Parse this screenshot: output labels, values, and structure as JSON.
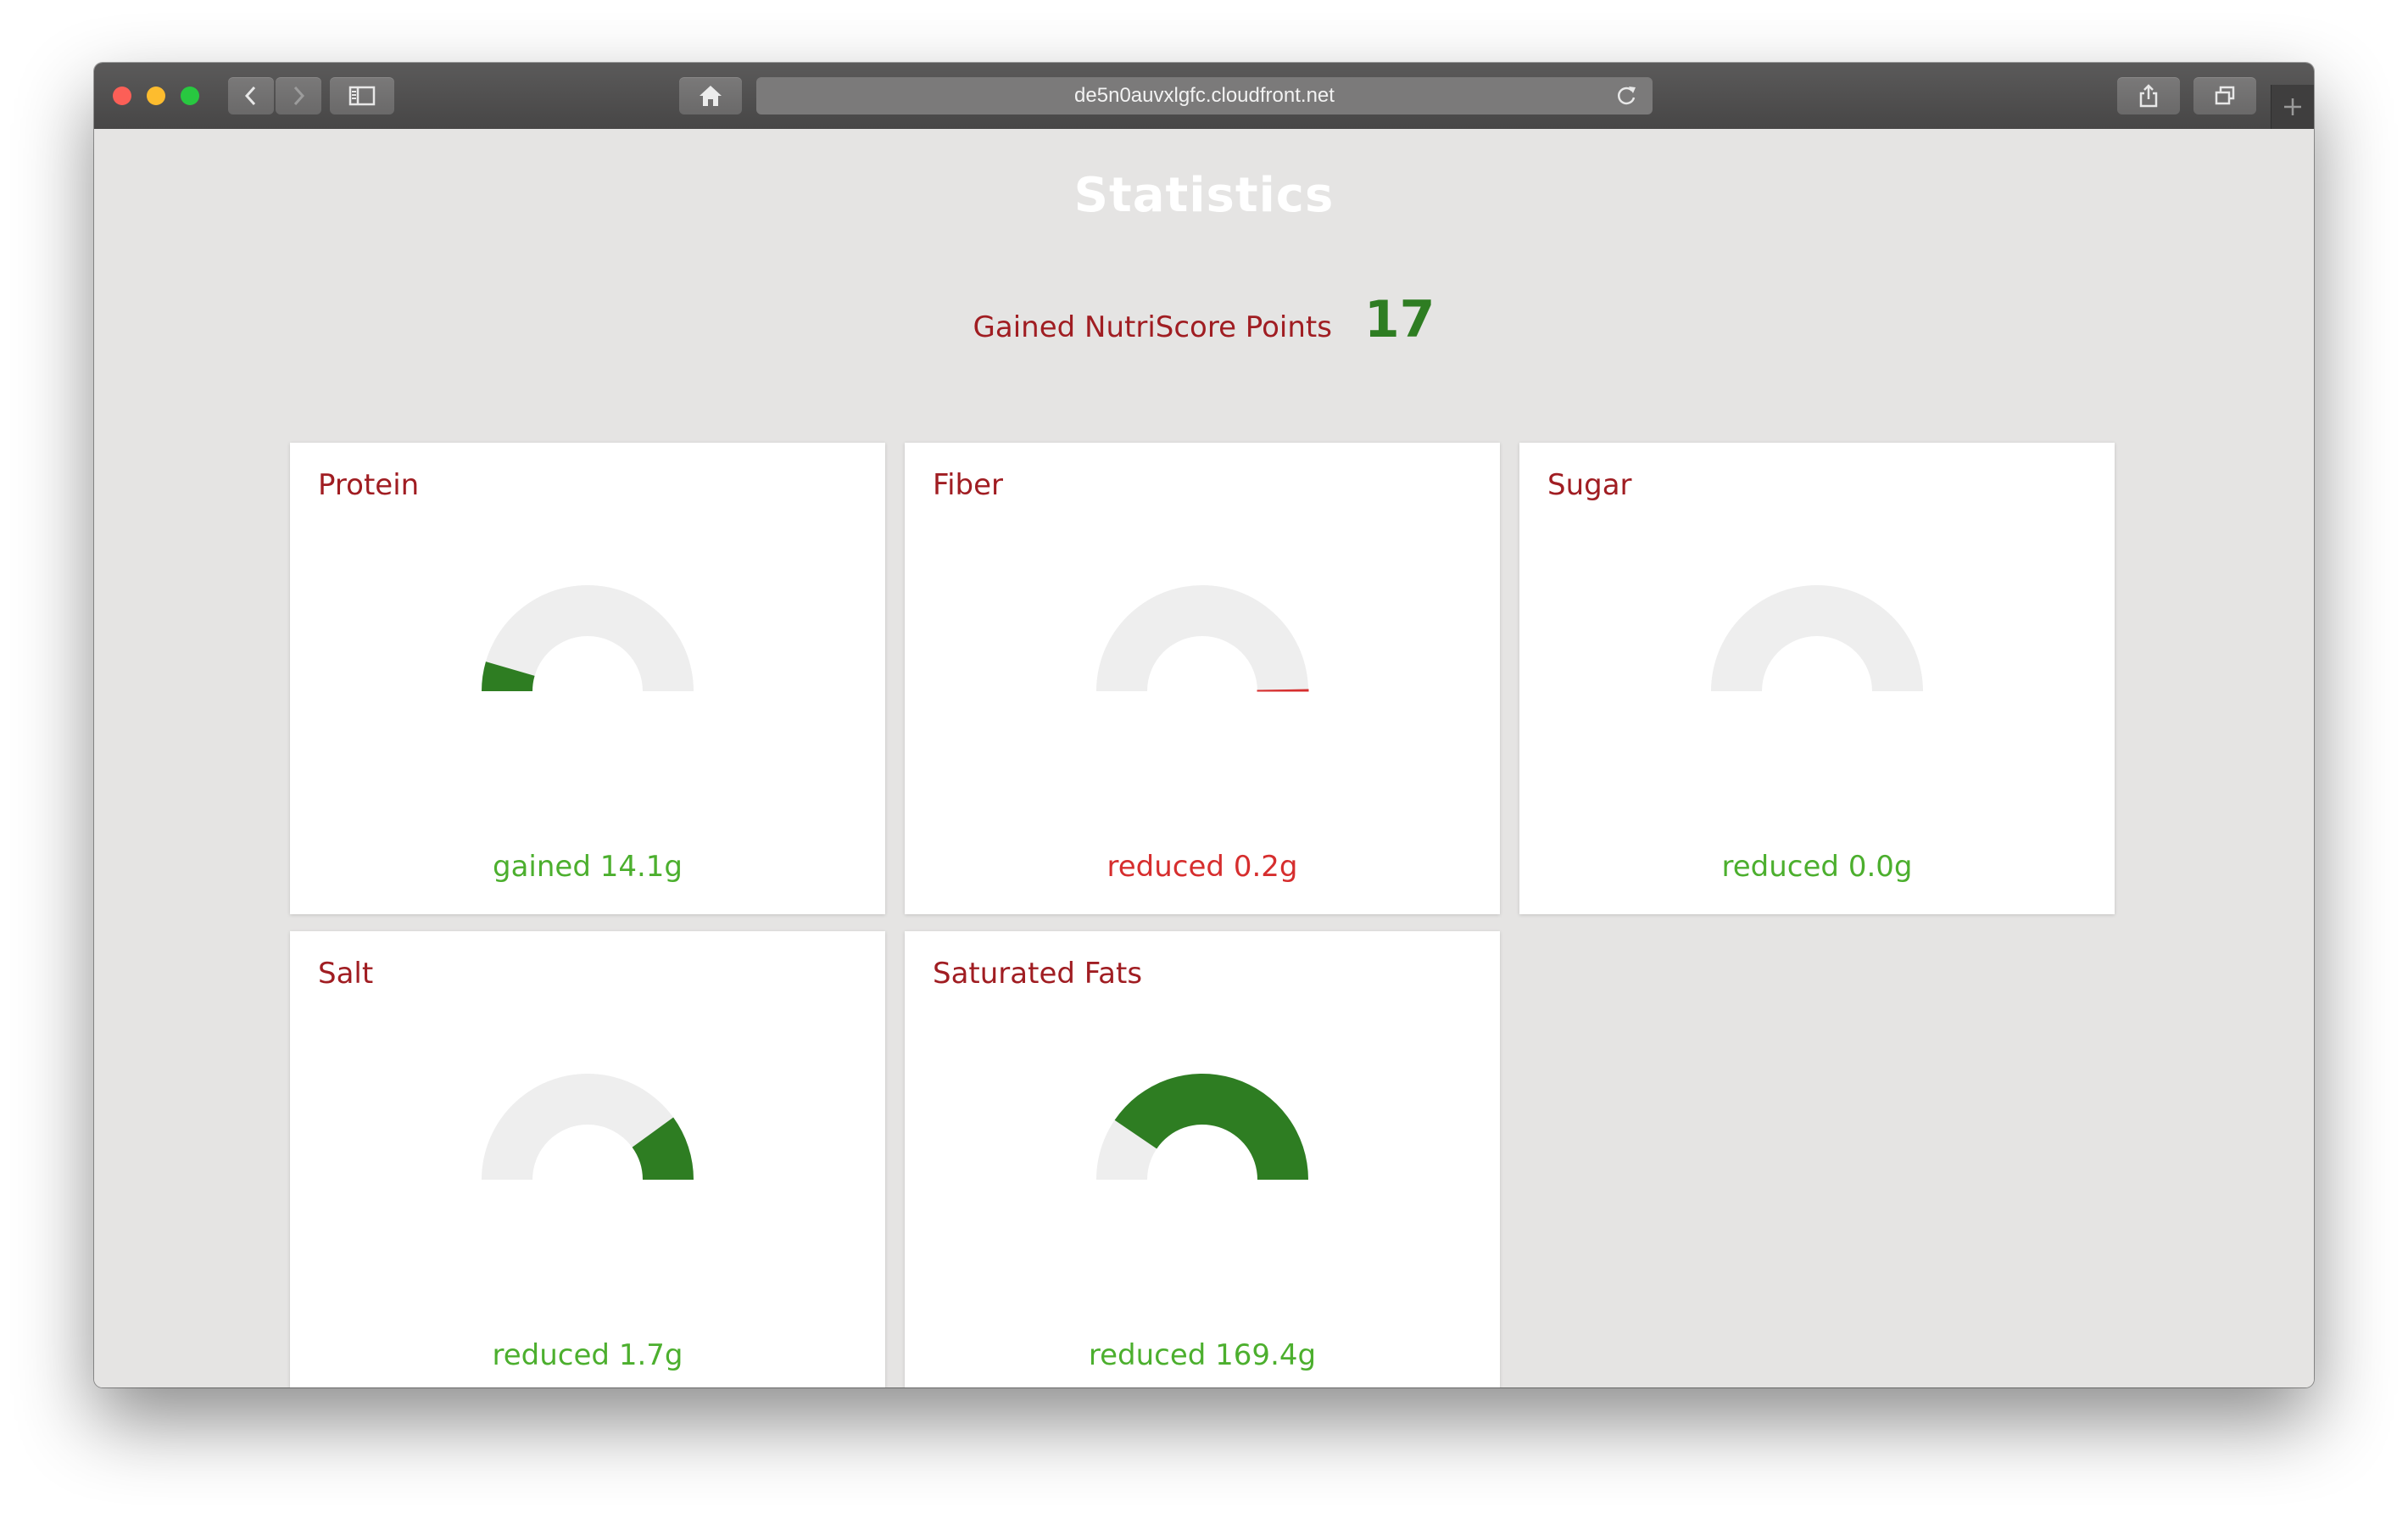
{
  "browser": {
    "url": "de5n0auvxlgfc.cloudfront.net"
  },
  "page": {
    "title": "Statistics",
    "score_label": "Gained NutriScore Points",
    "score_value": "17"
  },
  "colors": {
    "gauge_track": "#eeeeee",
    "gauge_good": "#2e7d22",
    "gauge_bad": "#d62e2e",
    "label_red": "#a01d22",
    "text_good": "#4caf2e",
    "text_bad": "#d62e2e"
  },
  "cards": [
    {
      "name": "Protein",
      "value_text": "gained 14.1g",
      "gauge_fraction": 0.09,
      "gauge_from": "left",
      "status": "good"
    },
    {
      "name": "Fiber",
      "value_text": "reduced 0.2g",
      "gauge_fraction": 0.005,
      "gauge_from": "right",
      "status": "bad"
    },
    {
      "name": "Sugar",
      "value_text": "reduced 0.0g",
      "gauge_fraction": 0.0,
      "gauge_from": "right",
      "status": "good"
    },
    {
      "name": "Salt",
      "value_text": "reduced 1.7g",
      "gauge_fraction": 0.2,
      "gauge_from": "right",
      "status": "good"
    },
    {
      "name": "Saturated Fats",
      "value_text": "reduced 169.4g",
      "gauge_fraction": 0.81,
      "gauge_from": "right",
      "status": "good"
    }
  ]
}
